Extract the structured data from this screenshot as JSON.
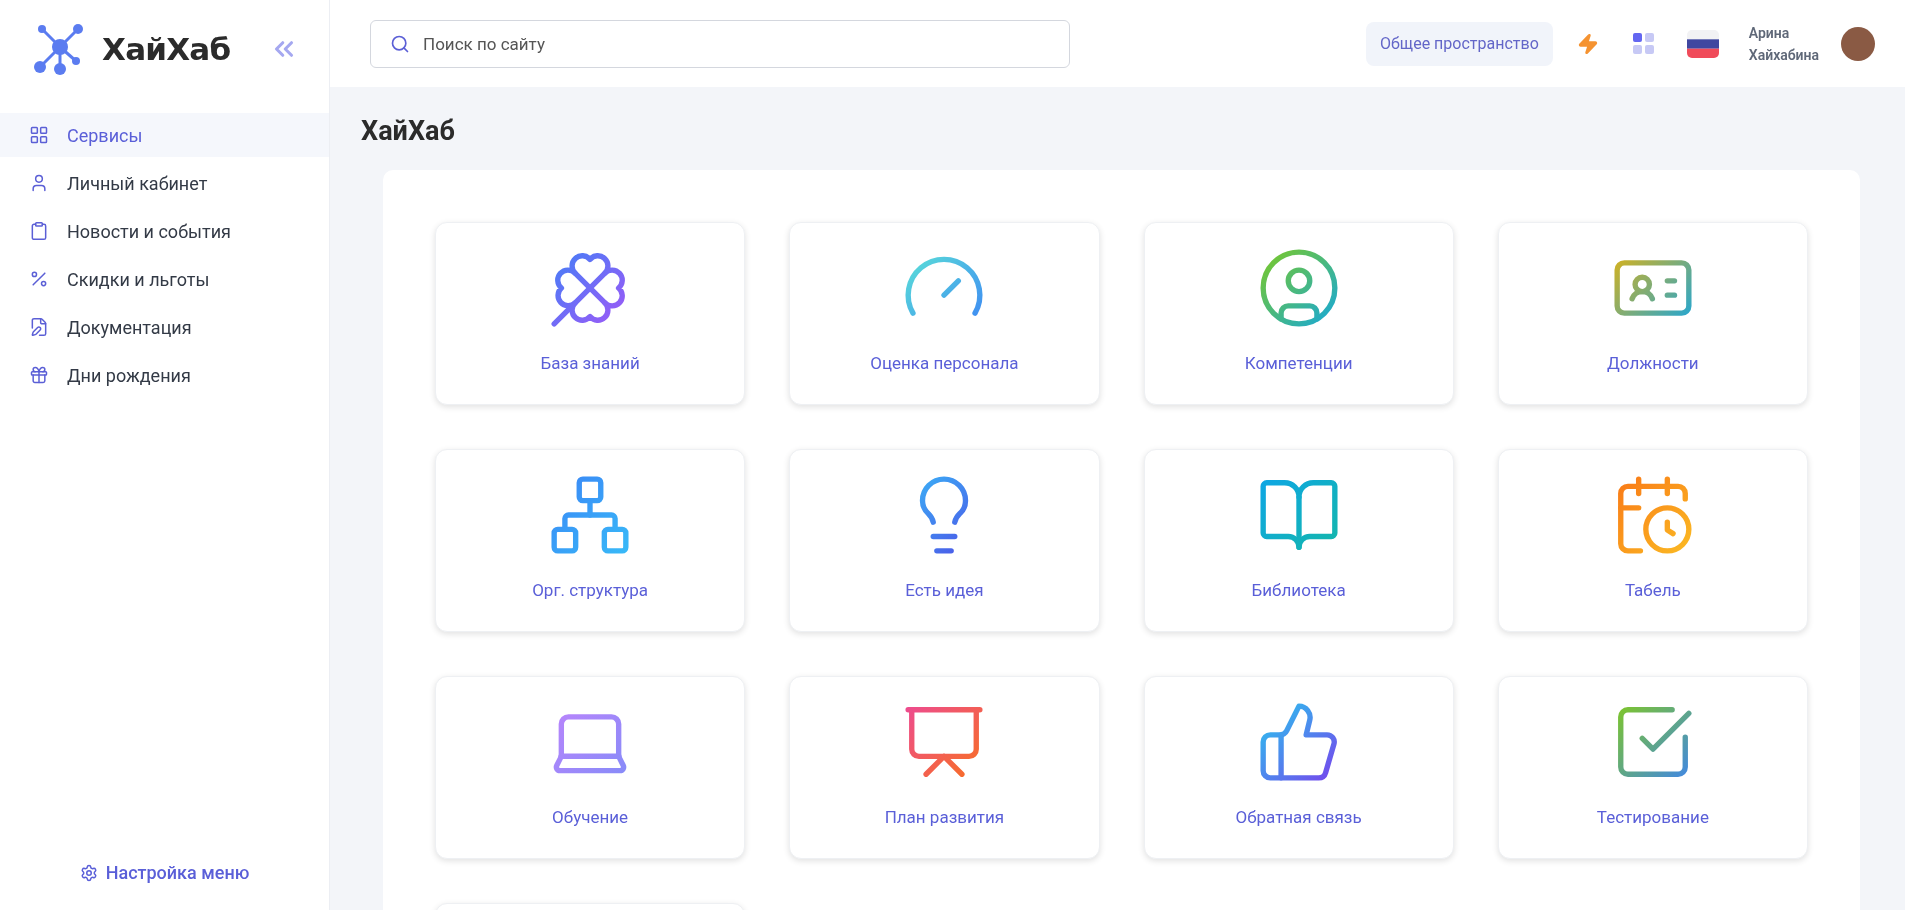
{
  "brand": {
    "name": "ХайХаб"
  },
  "sidebar": {
    "items": [
      {
        "label": "Сервисы",
        "selected": true
      },
      {
        "label": "Личный кабинет",
        "selected": false
      },
      {
        "label": "Новости и события",
        "selected": false
      },
      {
        "label": "Скидки и льготы",
        "selected": false
      },
      {
        "label": "Документация",
        "selected": false
      },
      {
        "label": "Дни рождения",
        "selected": false
      }
    ],
    "footer_link": "Настройка меню"
  },
  "header": {
    "search": {
      "placeholder": "Поиск по сайту"
    },
    "workspace_button": "Общее пространство",
    "user": {
      "first_name": "Арина",
      "last_name": "Хайхабина"
    }
  },
  "page_title": "ХайХаб",
  "services": [
    {
      "label": "База знаний"
    },
    {
      "label": "Оценка персонала"
    },
    {
      "label": "Компетенции"
    },
    {
      "label": "Должности"
    },
    {
      "label": "Орг. структура"
    },
    {
      "label": "Есть идея"
    },
    {
      "label": "Библиотека"
    },
    {
      "label": "Табель"
    },
    {
      "label": "Обучение"
    },
    {
      "label": "План развития"
    },
    {
      "label": "Обратная связь"
    },
    {
      "label": "Тестирование"
    }
  ]
}
